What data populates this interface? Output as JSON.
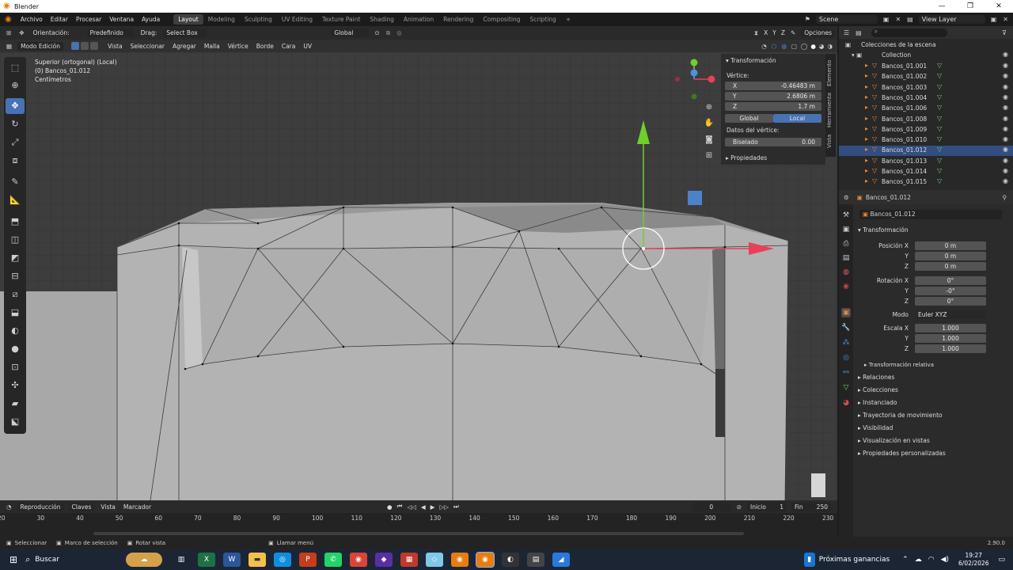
{
  "window": {
    "title": "Blender",
    "controls": [
      "—",
      "❐",
      "✕"
    ]
  },
  "menu": {
    "items": [
      "Archivo",
      "Editar",
      "Procesar",
      "Ventana",
      "Ayuda"
    ],
    "workspaces": [
      "Layout",
      "Modeling",
      "Sculpting",
      "UV Editing",
      "Texture Paint",
      "Shading",
      "Animation",
      "Rendering",
      "Compositing",
      "Scripting"
    ],
    "add_ws": "+",
    "scene": "Scene",
    "view_layer": "View Layer"
  },
  "toolheader": {
    "orientation_label": "Orientación:",
    "orientation_value": "Predefinido",
    "drag_label": "Drag:",
    "drag_value": "Select Box",
    "transform_orientation": "Global",
    "axes": [
      "X",
      "Y",
      "Z"
    ],
    "options": "Opciones"
  },
  "vpheader": {
    "mode": "Modo Edición",
    "menus": [
      "Vista",
      "Seleccionar",
      "Agregar",
      "Malla",
      "Vértice",
      "Borde",
      "Cara",
      "UV"
    ]
  },
  "viewport_info": {
    "line1": "Superior (ortogonal) (Local)",
    "line2": "(0) Bancos_01.012",
    "line3": "Centímetros"
  },
  "npanel": {
    "header": "Transformación",
    "vertex_label": "Vértice:",
    "x_label": "X",
    "x_value": "-0.46483 m",
    "y_label": "Y",
    "y_value": "2.6806 m",
    "z_label": "Z",
    "z_value": "1.7 m",
    "global_btn": "Global",
    "local_btn": "Local",
    "vertex_data": "Datos del vértice:",
    "bevel_label": "Biselado",
    "bevel_value": "0.00",
    "props": "Propiedades",
    "tabs": [
      "Elemento",
      "Herramienta",
      "Vista"
    ]
  },
  "outliner": {
    "root": "Colecciones de la escena",
    "collection": "Collection",
    "items": [
      "Bancos_01.001",
      "Bancos_01.002",
      "Bancos_01.003",
      "Bancos_01.004",
      "Bancos_01.006",
      "Bancos_01.008",
      "Bancos_01.009",
      "Bancos_01.010",
      "Bancos_01.012",
      "Bancos_01.013",
      "Bancos_01.014",
      "Bancos_01.015"
    ],
    "selected_index": 8
  },
  "properties": {
    "object_name": "Bancos_01.012",
    "object_field": "Bancos_01.012",
    "section": "Transformación",
    "pos_label": "Posición X",
    "pos_x": "0 m",
    "pos_y": "0 m",
    "pos_z": "0 m",
    "rot_label": "Rotación X",
    "rot_x": "0°",
    "rot_y": "-0°",
    "rot_z": "0°",
    "mode_label": "Modo",
    "mode_value": "Euler XYZ",
    "scale_label": "Escala X",
    "scale_x": "1.000",
    "scale_y": "1.000",
    "scale_z": "1.000",
    "y": "Y",
    "z": "Z",
    "relative": "Transformación relativa",
    "sections": [
      "Relaciones",
      "Colecciones",
      "Instanciado",
      "Trayectoria de movimiento",
      "Visibilidad",
      "Visualización en vistas",
      "Propiedades personalizadas"
    ]
  },
  "timeline": {
    "menus": [
      "Reproducción",
      "Claves",
      "Vista",
      "Marcador"
    ],
    "current_frame": "0",
    "start_label": "Inicio",
    "start": "1",
    "end_label": "Fin",
    "end": "250",
    "ticks": [
      "20",
      "30",
      "40",
      "50",
      "60",
      "70",
      "80",
      "90",
      "100",
      "110",
      "120",
      "130",
      "140",
      "150",
      "160",
      "170",
      "180",
      "190",
      "200",
      "210",
      "220",
      "230"
    ]
  },
  "status": {
    "items": [
      "Seleccionar",
      "Marco de selección",
      "Rotar vista",
      "Llamar menú"
    ],
    "version": "2.90.0"
  },
  "taskbar": {
    "search": "Buscar",
    "news": "Próximas ganancias",
    "time": "19:27",
    "date": "6/02/2026"
  },
  "colors": {
    "accent": "#4772b3",
    "x_axis": "#e8405a",
    "y_axis": "#6fcf2a",
    "z_axis": "#4f8fe0",
    "object": "#e8883b"
  }
}
